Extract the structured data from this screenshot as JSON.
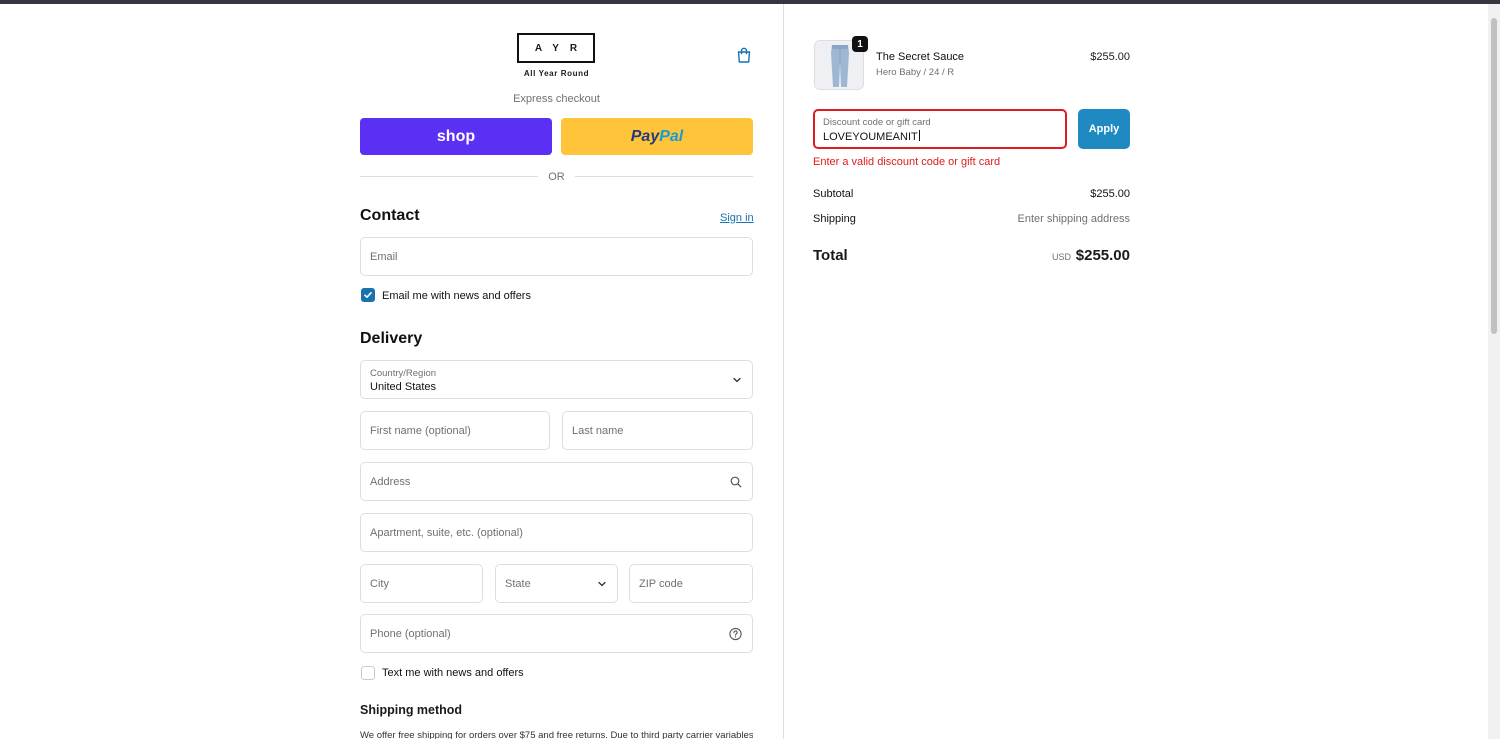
{
  "brand": {
    "logo_text": "AYR",
    "tagline": "All Year Round"
  },
  "express": {
    "label": "Express checkout",
    "shop_label": "shop",
    "paypal_pay": "Pay",
    "paypal_pal": "Pal",
    "or_label": "OR"
  },
  "contact": {
    "heading": "Contact",
    "signin_label": "Sign in",
    "email_placeholder": "Email",
    "newsletter_label": "Email me with news and offers",
    "newsletter_checked": true
  },
  "delivery": {
    "heading": "Delivery",
    "country_label": "Country/Region",
    "country_value": "United States",
    "first_name_placeholder": "First name (optional)",
    "last_name_placeholder": "Last name",
    "address_placeholder": "Address",
    "apartment_placeholder": "Apartment, suite, etc. (optional)",
    "city_placeholder": "City",
    "state_placeholder": "State",
    "zip_placeholder": "ZIP code",
    "phone_placeholder": "Phone (optional)",
    "sms_label": "Text me with news and offers",
    "sms_checked": false
  },
  "shipping_method": {
    "heading": "Shipping method",
    "text": "We offer free shipping for orders over $75 and free returns. Due to third party carrier variables,"
  },
  "order": {
    "item": {
      "name": "The Secret Sauce",
      "variant": "Hero Baby / 24 / R",
      "price": "$255.00",
      "quantity": "1"
    },
    "discount": {
      "label": "Discount code or gift card",
      "value": "LOVEYOUMEANIT",
      "apply_label": "Apply",
      "error": "Enter a valid discount code or gift card"
    },
    "subtotal_label": "Subtotal",
    "subtotal_value": "$255.00",
    "shipping_label": "Shipping",
    "shipping_value": "Enter shipping address",
    "total_label": "Total",
    "total_currency": "USD",
    "total_value": "$255.00"
  },
  "colors": {
    "accent": "#1773b0",
    "apply_button": "#1f8ac2",
    "error": "#dd1d1d",
    "shop_pay": "#5a31f4",
    "paypal": "#ffc439"
  }
}
